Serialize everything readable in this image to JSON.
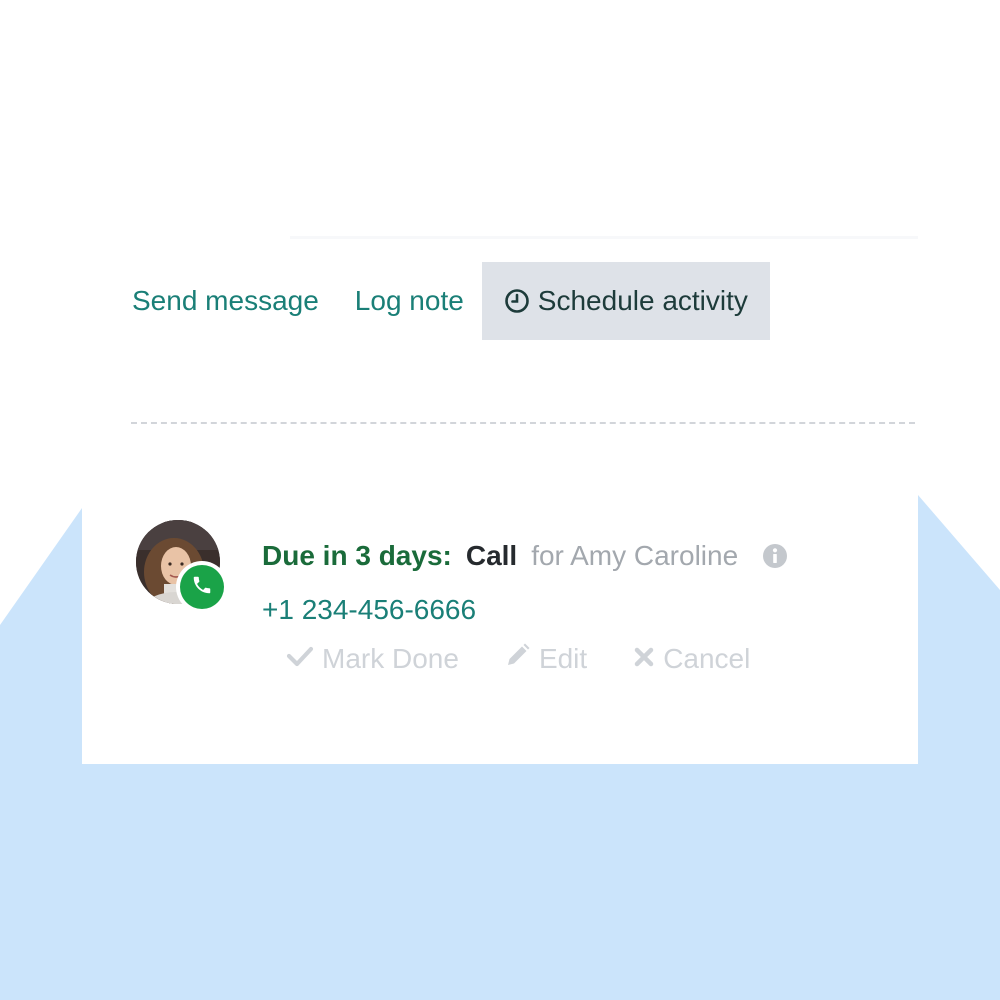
{
  "tabs": {
    "send_message": "Send message",
    "log_note": "Log note",
    "schedule_activity": "Schedule activity"
  },
  "activity": {
    "due": "Due in 3 days:",
    "type": "Call",
    "assignee": "for Amy Caroline",
    "phone": "+1 234-456-6666",
    "actions": {
      "mark_done": "Mark Done",
      "edit": "Edit",
      "cancel": "Cancel"
    }
  },
  "icons": {
    "schedule": "clock-icon",
    "badge": "phone-icon",
    "info": "info-icon",
    "mark_done": "check-icon",
    "edit": "pencil-icon",
    "cancel": "close-icon"
  },
  "colors": {
    "accent": "#1a7f77",
    "due": "#1a6b3a",
    "badge": "#1aa348",
    "background_shape": "#cbe4fb",
    "active_tab": "#dee2e8"
  }
}
